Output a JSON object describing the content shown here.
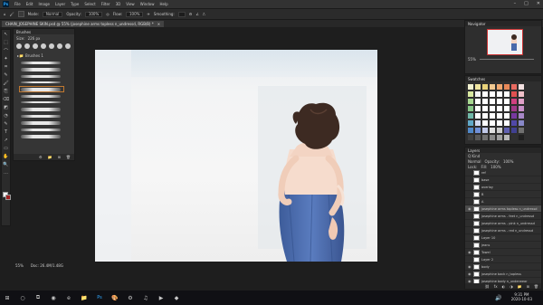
{
  "menubar": {
    "app_icon": "Ps",
    "items": [
      "File",
      "Edit",
      "Image",
      "Layer",
      "Type",
      "Select",
      "Filter",
      "3D",
      "View",
      "Window",
      "Help"
    ],
    "window_controls": [
      "–",
      "□",
      "✕"
    ]
  },
  "options_bar": {
    "mode_label": "Mode:",
    "mode_value": "Normal",
    "opacity_label": "Opacity:",
    "opacity_value": "100%",
    "flow_label": "Flow:",
    "flow_value": "100%",
    "smoothing_label": "Smoothing:"
  },
  "document_tab": {
    "title": "CHAIN_JOSEPHINE SKIN.psd @ 55% (josephine arms topless n_undressd, RGB/8) *",
    "close": "×"
  },
  "tools": [
    "↖",
    "⬚",
    "⌒",
    "✦",
    "⌗",
    "✎",
    "🖌",
    "⎘",
    "⌫",
    "◩",
    "◔",
    "✎",
    "T",
    "↗",
    "▭",
    "✋",
    "🔍",
    "…"
  ],
  "brushes_panel": {
    "title": "Brushes",
    "size_label": "Size:",
    "size_value": "226 px",
    "group_label": "Brushes 1",
    "footer_icons": [
      "⚙",
      "📁",
      "⊞",
      "🗑"
    ]
  },
  "status": {
    "zoom": "55%",
    "doc": "Doc: 26.4M/1.48G"
  },
  "navigator": {
    "title": "Navigator",
    "zoom": "55%"
  },
  "color_panel": {
    "tab": "Swatches",
    "swatches": [
      "#f2f2d0",
      "#f0e6a0",
      "#e8d27a",
      "#f2c890",
      "#f0a870",
      "#e88858",
      "#e86a60",
      "#f2e0e0",
      "#d8e8a0",
      "#f4f4f4",
      "#fff",
      "#fff",
      "#fff",
      "#fff",
      "#e05050",
      "#f0c0c8",
      "#a8d890",
      "#fff",
      "#fff",
      "#fff",
      "#fff",
      "#fff",
      "#d04080",
      "#e0a0c8",
      "#88c888",
      "#fff",
      "#fff",
      "#fff",
      "#fff",
      "#fff",
      "#a03888",
      "#c890c8",
      "#70b8a8",
      "#fff",
      "#fff",
      "#fff",
      "#fff",
      "#fff",
      "#7838a0",
      "#a888c8",
      "#60a8c8",
      "#d0d8f0",
      "#fff",
      "#fff",
      "#fff",
      "#fff",
      "#5048a8",
      "#8888c8",
      "#5088c8",
      "#7090d8",
      "#c0c8e8",
      "#e0e0e0",
      "#cccccc",
      "#6060b0",
      "#404090",
      "#707070",
      "#404040",
      "#585858",
      "#707070",
      "#888888",
      "#a0a0a0",
      "#b8b8b8",
      "#303030",
      "#202020"
    ]
  },
  "layers_panel": {
    "title": "Layers",
    "kind_label": "Q Kind",
    "blend_mode": "Normal",
    "opacity_label": "Opacity:",
    "opacity_value": "100%",
    "lock_label": "Lock:",
    "fill_label": "Fill:",
    "fill_value": "100%",
    "layers": [
      {
        "name": "ref",
        "visible": false
      },
      {
        "name": "base",
        "visible": false
      },
      {
        "name": "overlay",
        "visible": false
      },
      {
        "name": "B",
        "visible": false
      },
      {
        "name": "A",
        "visible": false
      },
      {
        "name": "josephine arms topless n_undressd",
        "visible": true
      },
      {
        "name": "josephine arms - feet n_undressd",
        "visible": false
      },
      {
        "name": "josephine arms - pink n_undressd",
        "visible": false
      },
      {
        "name": "josephine arms - red n_undressd",
        "visible": false
      },
      {
        "name": "Layer 10",
        "visible": false
      },
      {
        "name": "jeans",
        "visible": false
      },
      {
        "name": "Towel",
        "visible": true
      },
      {
        "name": "Layer 2",
        "visible": false
      },
      {
        "name": "body",
        "visible": true
      },
      {
        "name": "josephine back n_topless",
        "visible": true
      },
      {
        "name": "josephine body n_underwear",
        "visible": true
      }
    ],
    "footer_icons": [
      "⛓",
      "fx",
      "◐",
      "◑",
      "📁",
      "⊞",
      "🗑"
    ]
  },
  "taskbar": {
    "icons": [
      "⊞",
      "○",
      "⧉",
      "◉",
      "e",
      "📁",
      "Ps",
      "🎨",
      "⚙",
      "♫",
      "▶",
      "◆",
      "🔊"
    ],
    "time": "9:31 PM",
    "date": "2020-10-03"
  }
}
